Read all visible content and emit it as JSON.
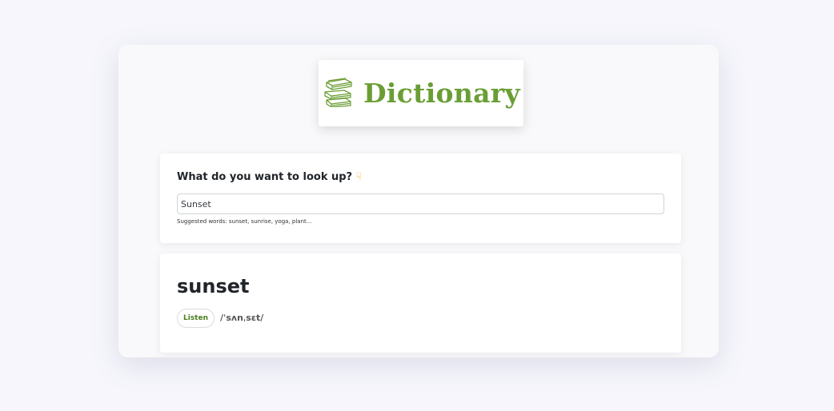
{
  "logo": {
    "text": "Dictionary",
    "icon": "books-icon",
    "color": "#6a9e35"
  },
  "search": {
    "heading": "What do you want to look up?",
    "heading_icon": "pointing-down-hand-icon",
    "value": "Sunset",
    "suggestions": "Suggested words: sunset, sunrise, yoga, plant..."
  },
  "result": {
    "word": "sunset",
    "listen_label": "Listen",
    "phonetic": "/ˈsʌnˌsɛt/"
  }
}
